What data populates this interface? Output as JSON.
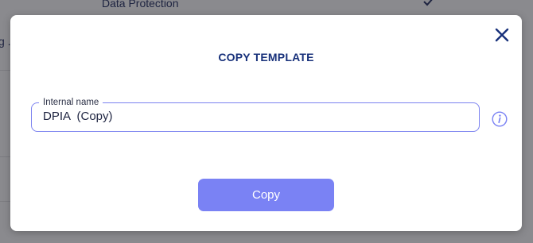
{
  "background": {
    "row_label": "Data Protection",
    "edge_text": "g ..."
  },
  "modal": {
    "title": "COPY TEMPLATE",
    "field": {
      "label": "Internal name",
      "value": "DPIA  (Copy)"
    },
    "submit_label": "Copy"
  },
  "colors": {
    "accent": "#7a82f4",
    "title": "#17307a",
    "field_border": "#7b82f0"
  },
  "icons": {
    "close": "close-icon",
    "info": "info-icon",
    "check": "checkmark-icon"
  }
}
